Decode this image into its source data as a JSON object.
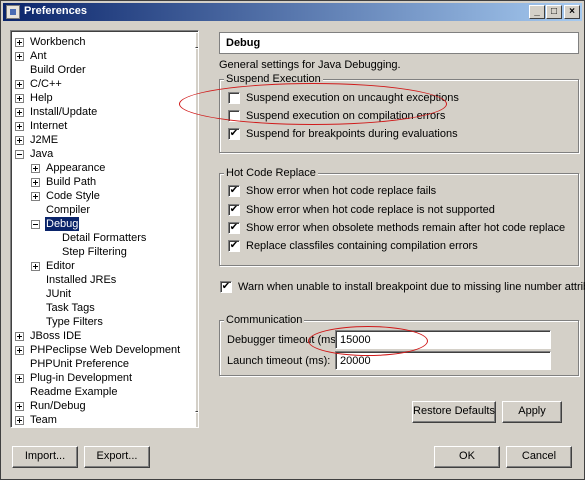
{
  "window": {
    "title": "Preferences"
  },
  "title_buttons": {
    "minimize": "_",
    "maximize": "□",
    "close": "×"
  },
  "tree": {
    "items": [
      {
        "label": "Workbench",
        "expander": "plus",
        "level": 0
      },
      {
        "label": "Ant",
        "expander": "plus",
        "level": 0
      },
      {
        "label": "Build Order",
        "expander": "none",
        "level": 0
      },
      {
        "label": "C/C++",
        "expander": "plus",
        "level": 0
      },
      {
        "label": "Help",
        "expander": "plus",
        "level": 0
      },
      {
        "label": "Install/Update",
        "expander": "plus",
        "level": 0
      },
      {
        "label": "Internet",
        "expander": "plus",
        "level": 0
      },
      {
        "label": "J2ME",
        "expander": "plus",
        "level": 0
      },
      {
        "label": "Java",
        "expander": "minus",
        "level": 0
      },
      {
        "label": "Appearance",
        "expander": "plus",
        "level": 1
      },
      {
        "label": "Build Path",
        "expander": "plus",
        "level": 1
      },
      {
        "label": "Code Style",
        "expander": "plus",
        "level": 1
      },
      {
        "label": "Compiler",
        "expander": "none",
        "level": 1
      },
      {
        "label": "Debug",
        "expander": "minus",
        "level": 1,
        "selected": true
      },
      {
        "label": "Detail Formatters",
        "expander": "none",
        "level": 2
      },
      {
        "label": "Step Filtering",
        "expander": "none",
        "level": 2
      },
      {
        "label": "Editor",
        "expander": "plus",
        "level": 1
      },
      {
        "label": "Installed JREs",
        "expander": "none",
        "level": 1
      },
      {
        "label": "JUnit",
        "expander": "none",
        "level": 1
      },
      {
        "label": "Task Tags",
        "expander": "none",
        "level": 1
      },
      {
        "label": "Type Filters",
        "expander": "none",
        "level": 1
      },
      {
        "label": "JBoss IDE",
        "expander": "plus",
        "level": 0
      },
      {
        "label": "PHPeclipse Web Development",
        "expander": "plus",
        "level": 0
      },
      {
        "label": "PHPUnit Preference",
        "expander": "none",
        "level": 0
      },
      {
        "label": "Plug-in Development",
        "expander": "plus",
        "level": 0
      },
      {
        "label": "Readme Example",
        "expander": "none",
        "level": 0
      },
      {
        "label": "Run/Debug",
        "expander": "plus",
        "level": 0
      },
      {
        "label": "Team",
        "expander": "plus",
        "level": 0
      }
    ]
  },
  "page": {
    "title": "Debug",
    "description": "General settings for Java Debugging."
  },
  "suspend_group": {
    "title": "Suspend Execution",
    "options": [
      {
        "label": "Suspend execution on uncaught exceptions",
        "checked": false
      },
      {
        "label": "Suspend execution on compilation errors",
        "checked": false
      },
      {
        "label": "Suspend for breakpoints during evaluations",
        "checked": true
      }
    ]
  },
  "hcr_group": {
    "title": "Hot Code Replace",
    "options": [
      {
        "label": "Show error when hot code replace fails",
        "checked": true
      },
      {
        "label": "Show error when hot code replace is not supported",
        "checked": true
      },
      {
        "label": "Show error when obsolete methods remain after hot code replace",
        "checked": true
      },
      {
        "label": "Replace classfiles containing compilation errors",
        "checked": true
      }
    ]
  },
  "warn_option": {
    "label": "Warn when unable to install breakpoint due to missing line number attributes",
    "checked": true
  },
  "communication": {
    "title": "Communication",
    "debugger_timeout_label": "Debugger timeout (ms):",
    "debugger_timeout_value": "15000",
    "launch_timeout_label": "Launch timeout (ms):",
    "launch_timeout_value": "20000"
  },
  "buttons": {
    "restore_defaults": "Restore Defaults",
    "apply": "Apply",
    "import": "Import...",
    "export": "Export...",
    "ok": "OK",
    "cancel": "Cancel"
  },
  "check_glyph": "✔",
  "colors": {
    "annotation": "#d01a1a",
    "selection": "#0a246a",
    "titlebar_start": "#0a246a",
    "titlebar_end": "#a6caf0"
  }
}
